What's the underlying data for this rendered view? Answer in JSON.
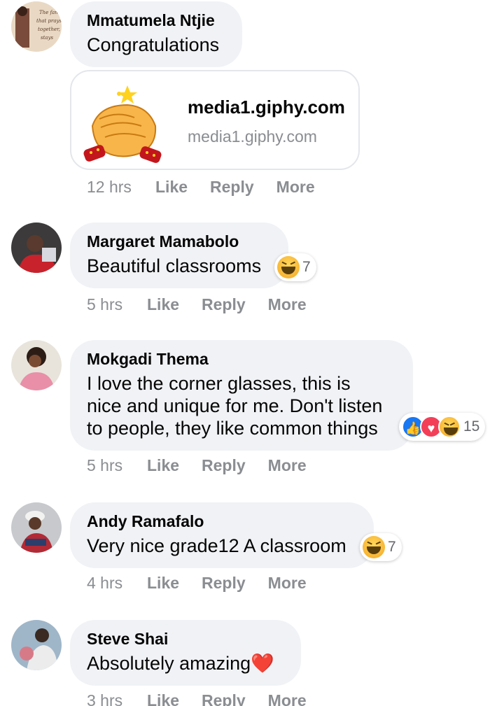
{
  "comments": [
    {
      "author": "Mmatumela Ntjie",
      "text": "Congratulations",
      "time": "12 hrs",
      "link_preview": {
        "title": "media1.giphy.com",
        "domain": "media1.giphy.com"
      }
    },
    {
      "author": "Margaret Mamabolo",
      "text": "Beautiful classrooms",
      "time": "5 hrs",
      "reaction_count": "7",
      "reactions": [
        "haha"
      ]
    },
    {
      "author": "Mokgadi Thema",
      "text": "I love the corner glasses, this is nice and unique for me. Don't listen to people, they like common things",
      "text_lines": [
        "I love the corner glasses, this is",
        "nice and unique for me. Don't listen",
        "to people, they like common things"
      ],
      "time": "5 hrs",
      "reaction_count": "15",
      "reactions": [
        "like",
        "love",
        "haha"
      ]
    },
    {
      "author": "Andy Ramafalo",
      "text": "Very nice grade12 A classroom",
      "time": "4 hrs",
      "reaction_count": "7",
      "reactions": [
        "haha"
      ]
    },
    {
      "author": "Steve Shai",
      "text": "Absolutely amazing",
      "emoji_suffix": "❤️",
      "time": "3 hrs"
    }
  ],
  "actions": {
    "like": "Like",
    "reply": "Reply",
    "more": "More"
  },
  "colors": {
    "bubble": "#f0f2f5",
    "meta": "#8a8d91",
    "like_blue": "#1877f2",
    "love_red": "#f33e58"
  }
}
